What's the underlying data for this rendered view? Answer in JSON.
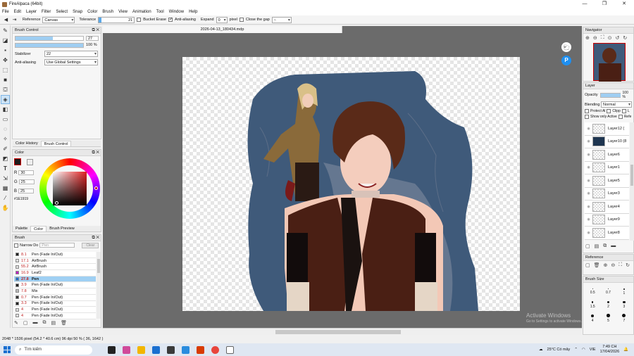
{
  "window": {
    "title": "FireAlpaca (64bit)",
    "minimize": "—",
    "maximize": "❐",
    "close": "✕"
  },
  "menu": [
    "File",
    "Edit",
    "Layer",
    "Filter",
    "Select",
    "Snap",
    "Color",
    "Brush",
    "View",
    "Animation",
    "Tool",
    "Window",
    "Help"
  ],
  "toolopts": {
    "reference_label": "Reference",
    "reference_value": "Canvas",
    "tolerance_label": "Tolerance",
    "tolerance_value": "21",
    "tolerance_pct": 0.08,
    "bucket_erase": "Bucket Erase",
    "antialiasing": "Anti-aliasing",
    "expand_label": "Expand",
    "expand_value": "0",
    "pixel": "pixel",
    "close_gap": "Close the gap",
    "gap_value": "<"
  },
  "brush_control": {
    "title": "Brush Control",
    "size": "27",
    "size_fill": 0.55,
    "opacity": "100 %",
    "opacity_fill": 1.0,
    "stabilizer_label": "Stabilizer",
    "stabilizer_value": "22",
    "aa_label": "Anti-aliasing",
    "aa_value": "Use Global Settings"
  },
  "left_tabs": {
    "tab1": "Color History",
    "tab2": "Brush Control"
  },
  "color": {
    "title": "Color",
    "r": "30",
    "g": "25",
    "b": "25",
    "r_label": "R",
    "g_label": "G",
    "b_label": "B",
    "hex": "#1E1919",
    "swatch": "#1e1919"
  },
  "color_tabs": {
    "palette": "Palette",
    "color": "Color",
    "preview": "Brush Preview"
  },
  "brush": {
    "title": "Brush",
    "narrow": "Narrow Do",
    "search": "Pen",
    "clear": "Clear",
    "items": [
      {
        "size": "8.1",
        "name": "Pen (Fade In/Out)",
        "color": "#222222"
      },
      {
        "size": "17.1",
        "name": "AirBrush",
        "color": "#dddddd"
      },
      {
        "size": "55.2",
        "name": "AirBrush",
        "color": "#dddddd"
      },
      {
        "size": "16.9",
        "name": "Leaf2",
        "color": "#c020c0"
      },
      {
        "size": "27.8",
        "name": "Pen",
        "color": "#1a6fd0"
      },
      {
        "size": "3.9",
        "name": "Pen (Fade In/Out)",
        "color": "#222222"
      },
      {
        "size": "7.8",
        "name": "Mix",
        "color": "#bbbbbb"
      },
      {
        "size": "0.7",
        "name": "Pen (Fade In/Out)",
        "color": "#333333"
      },
      {
        "size": "3.3",
        "name": "Pen (Fade In/Out)",
        "color": "#222222"
      },
      {
        "size": "4",
        "name": "Pen (Fade In/Out)",
        "color": "#dddddd"
      },
      {
        "size": "4",
        "name": "Pen (Fade In/Out)",
        "color": "#dddddd"
      }
    ]
  },
  "document": {
    "tab": "2026-04-13_180434.mdp"
  },
  "navigator": {
    "title": "Navigator"
  },
  "layer": {
    "title": "Layer",
    "opacity_label": "Opacity",
    "opacity_value": "100 %",
    "blending_label": "Blending",
    "blending_value": "Normal",
    "protect": "Protect Al",
    "clip": "Clipp",
    "lock": "L",
    "show_active": "Show only Active",
    "refer": "Refe",
    "items": [
      "Layer12 (",
      "Layer10 (8",
      "Layer6",
      "Layer1",
      "Layer5",
      "Layer3",
      "Layer4",
      "Layer9",
      "Layer8"
    ]
  },
  "reference": {
    "title": "Reference"
  },
  "brush_size": {
    "title": "Brush Size",
    "values": [
      "0.5",
      "0.7",
      "1",
      "1.5",
      "2",
      "3",
      "4",
      "5",
      "7"
    ]
  },
  "status": "2048 * 1536 pixel  (54.2 * 40.6 cm)  96 dpi  50 %  ( 36, 1642 )",
  "activate": {
    "line1": "Activate Windows",
    "line2": "Go to Settings to activate Windows."
  },
  "taskbar": {
    "search": "Tìm kiếm",
    "weather": "25°C  Có mây",
    "lang": "VIE",
    "time": "7:49 CH",
    "date": "17/04/2026"
  }
}
